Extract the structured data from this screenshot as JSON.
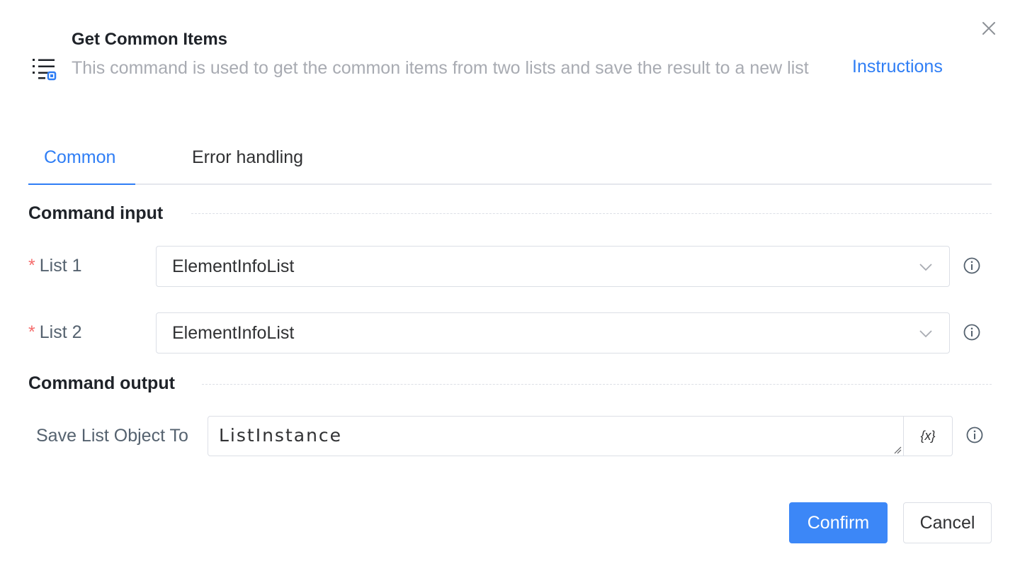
{
  "header": {
    "icon": "list-command-icon",
    "title": "Get Common Items",
    "description": "This command is used to get the common items from two lists and save the result to a new list",
    "instructions_link": "Instructions",
    "close_icon": "close-icon"
  },
  "tabs": [
    {
      "label": "Common",
      "active": true
    },
    {
      "label": "Error handling",
      "active": false
    }
  ],
  "sections": {
    "input_title": "Command input",
    "output_title": "Command output"
  },
  "fields": {
    "list1": {
      "label": "List 1",
      "required_mark": "*",
      "value": "ElementInfoList"
    },
    "list2": {
      "label": "List 2",
      "required_mark": "*",
      "value": "ElementInfoList"
    },
    "save_to": {
      "label": "Save List Object To",
      "value": "ListInstance",
      "variable_button": "{x}"
    }
  },
  "buttons": {
    "confirm": "Confirm",
    "cancel": "Cancel"
  },
  "colors": {
    "accent": "#2f7ef5",
    "required": "#f56c6c",
    "muted_text": "#a8abb2"
  }
}
